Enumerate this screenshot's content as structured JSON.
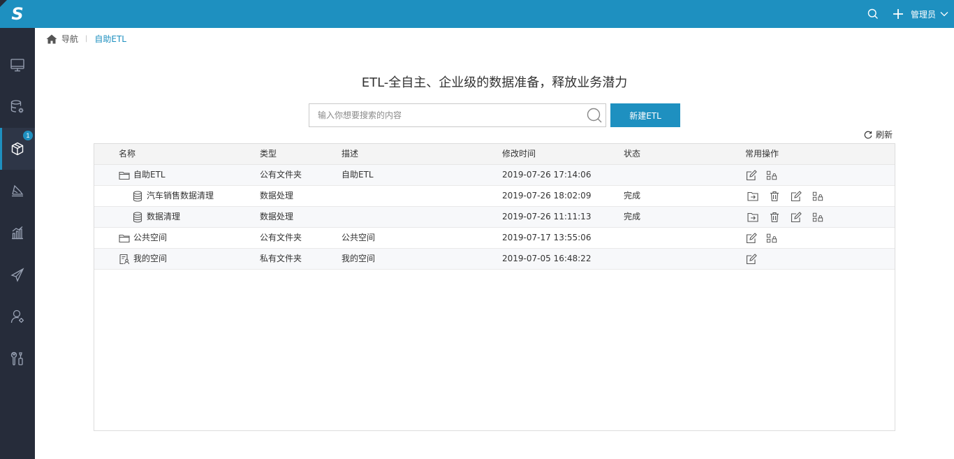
{
  "app": {
    "logo_letter": "S",
    "accent_color": "#1e90c0",
    "sidebar_color": "#262c3a"
  },
  "sidebar": {
    "items": [
      {
        "name": "monitor-icon"
      },
      {
        "name": "database-settings-icon"
      },
      {
        "name": "cube-icon",
        "badge": "1",
        "active": true
      },
      {
        "name": "layers-icon"
      },
      {
        "name": "bar-chart-icon"
      },
      {
        "name": "send-icon"
      },
      {
        "name": "user-settings-icon"
      },
      {
        "name": "tools-icon"
      }
    ]
  },
  "topbar": {
    "user_label": "管理员"
  },
  "breadcrumb": {
    "nav": "导航",
    "current": "自助ETL"
  },
  "headline": "ETL-全自主、企业级的数据准备，释放业务潜力",
  "search": {
    "placeholder": "输入你想要搜索的内容",
    "value": ""
  },
  "new_button": "新建ETL",
  "refresh_label": "刷新",
  "table": {
    "columns": {
      "name": "名称",
      "type": "类型",
      "desc": "描述",
      "time": "修改时间",
      "status": "状态",
      "ops": "常用操作"
    },
    "rows": [
      {
        "name": "自助ETL",
        "type": "公有文件夹",
        "desc": "自助ETL",
        "time": "2019-07-26 17:14:06",
        "status": "",
        "icon": "folder-icon",
        "indent": 0,
        "ops": [
          "edit-icon",
          "permission-icon"
        ]
      },
      {
        "name": "汽车销售数据清理",
        "type": "数据处理",
        "desc": "",
        "time": "2019-07-26 18:02:09",
        "status": "完成",
        "icon": "database-icon",
        "indent": 1,
        "ops": [
          "move-icon",
          "delete-icon",
          "edit-icon",
          "permission-icon"
        ]
      },
      {
        "name": "数据清理",
        "type": "数据处理",
        "desc": "",
        "time": "2019-07-26 11:11:13",
        "status": "完成",
        "icon": "database-icon",
        "indent": 1,
        "ops": [
          "move-icon",
          "delete-icon",
          "edit-icon",
          "permission-icon"
        ]
      },
      {
        "name": "公共空间",
        "type": "公有文件夹",
        "desc": "公共空间",
        "time": "2019-07-17 13:55:06",
        "status": "",
        "icon": "folder-icon",
        "indent": 0,
        "ops": [
          "edit-icon",
          "permission-icon"
        ]
      },
      {
        "name": "我的空间",
        "type": "私有文件夹",
        "desc": "我的空间",
        "time": "2019-07-05 16:48:22",
        "status": "",
        "icon": "private-folder-icon",
        "indent": 0,
        "ops": [
          "edit-icon"
        ]
      }
    ]
  }
}
